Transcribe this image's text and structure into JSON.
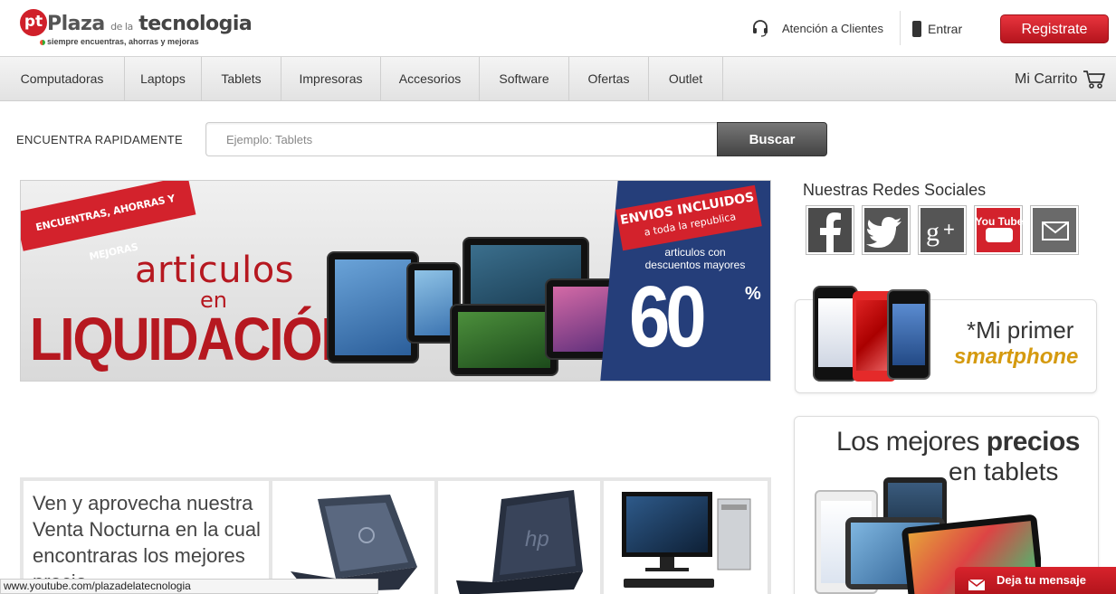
{
  "header": {
    "logo_badge": "pt",
    "logo_word1": "Plaza",
    "logo_word2": "de la",
    "logo_word3": "tecnologia",
    "logo_tagline": "siempre encuentras, ahorras y mejoras",
    "support_label": "Atención a Clientes",
    "login_label": "Entrar",
    "register_label": "Registrate"
  },
  "nav": {
    "items": [
      "Computadoras",
      "Laptops",
      "Tablets",
      "Impresoras",
      "Accesorios",
      "Software",
      "Ofertas",
      "Outlet"
    ],
    "cart_label": "Mi Carrito"
  },
  "search": {
    "label": "ENCUENTRA RAPIDAMENTE",
    "placeholder": "Ejemplo: Tablets",
    "button_label": "Buscar"
  },
  "banner": {
    "ribbon": "ENCUENTRAS, AHORRAS Y MEJORAS",
    "line1": "articulos",
    "line2": "en",
    "line3": "LIQUIDACIÓN",
    "shipping_line1": "ENVIOS INCLUIDOS",
    "shipping_line2": "a toda la republica",
    "discount_text": "articulos con descuentos mayores",
    "discount_value": "60",
    "discount_unit": "%"
  },
  "social": {
    "title": "Nuestras Redes Sociales",
    "networks": [
      {
        "name": "facebook",
        "bg": "#4b4b4b"
      },
      {
        "name": "twitter",
        "bg": "#555555"
      },
      {
        "name": "google-plus",
        "bg": "#555555"
      },
      {
        "name": "youtube",
        "bg": "#d3222c"
      },
      {
        "name": "email",
        "bg": "#6a6a6a"
      }
    ],
    "youtube_label": "You Tube"
  },
  "promo_smartphone": {
    "title": "*Mi primer",
    "subtitle": "smartphone"
  },
  "promo_tablets": {
    "title_prefix": "Los mejores",
    "title_bold": "precios",
    "title_line2": "en tablets"
  },
  "promo_night": {
    "text": "Ven y aprovecha nuestra Venta Nocturna en la cual encontraras los mejores precio"
  },
  "status_bar": {
    "url": "www.youtube.com/plazadelatecnologia"
  },
  "chat": {
    "label": "Deja tu mensaje"
  },
  "colors": {
    "brand_red": "#d3222c",
    "banner_blue": "#253e7a",
    "smartphone_gold": "#d59a0f"
  }
}
